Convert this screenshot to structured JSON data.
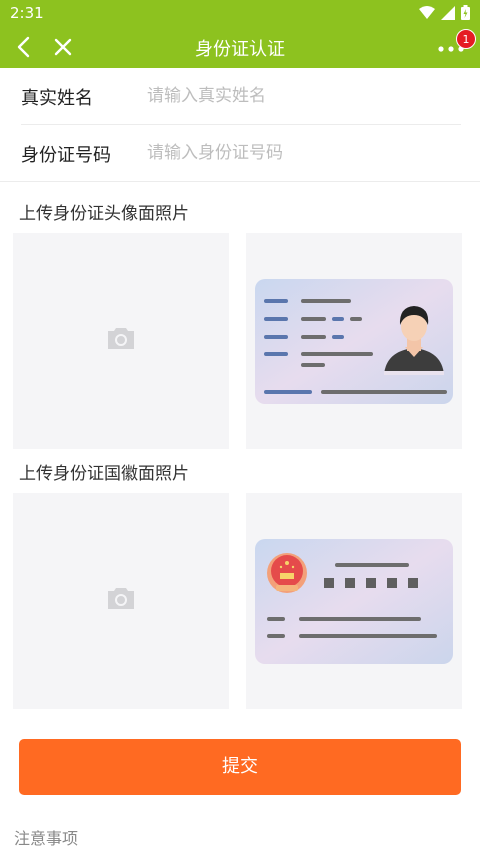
{
  "status_bar": {
    "time": "2:31"
  },
  "app_bar": {
    "title": "身份证认证",
    "notification_count": "1"
  },
  "form": {
    "name": {
      "label": "真实姓名",
      "placeholder": "请输入真实姓名",
      "value": ""
    },
    "id_number": {
      "label": "身份证号码",
      "placeholder": "请输入身份证号码",
      "value": ""
    }
  },
  "upload_front": {
    "title": "上传身份证头像面照片"
  },
  "upload_back": {
    "title": "上传身份证国徽面照片"
  },
  "submit_label": "提交",
  "notice_title": "注意事项",
  "colors": {
    "header": "#8dc21f",
    "accent": "#ff6a22",
    "badge": "#e51c23"
  }
}
